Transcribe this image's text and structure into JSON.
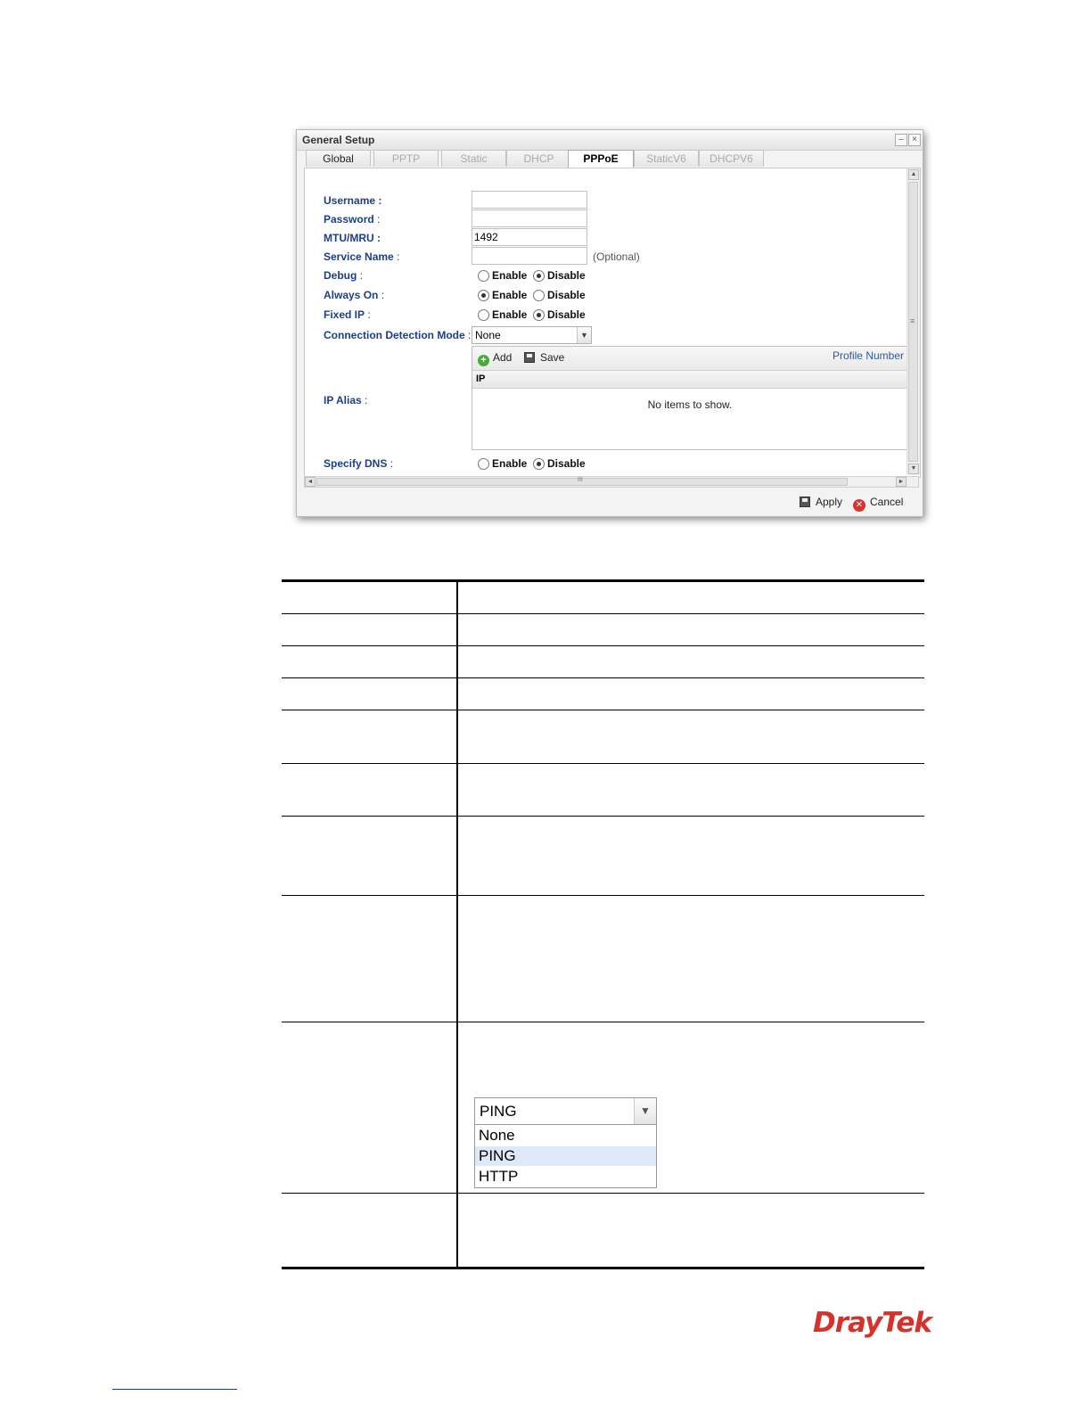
{
  "dialog": {
    "title": "General Setup",
    "minimize_glyph": "–",
    "close_glyph": "×",
    "tabs": [
      {
        "label": "Global",
        "state": "normal"
      },
      {
        "label": "PPTP",
        "state": "disabled"
      },
      {
        "label": "Static",
        "state": "disabled"
      },
      {
        "label": "DHCP",
        "state": "disabled"
      },
      {
        "label": "PPPoE",
        "state": "active"
      },
      {
        "label": "StaticV6",
        "state": "disabled"
      },
      {
        "label": "DHCPV6",
        "state": "disabled"
      }
    ],
    "form": {
      "username_label": "Username :",
      "username_value": "",
      "password_label": "Password",
      "password_colon": " :",
      "password_value": "",
      "mtu_label": "MTU/MRU :",
      "mtu_value": "1492",
      "service_label": "Service Name",
      "service_colon": " :",
      "service_value": "",
      "service_hint": "(Optional)",
      "debug_label": "Debug",
      "debug_colon": " :",
      "always_on_label": "Always On",
      "always_on_colon": " :",
      "fixed_ip_label": "Fixed IP",
      "fixed_ip_colon": " :",
      "conn_mode_label": "Connection Detection Mode",
      "conn_mode_colon": " :",
      "conn_mode_value": "None",
      "ip_alias_label": "IP Alias",
      "ip_alias_colon": " :",
      "specify_dns_label": "Specify DNS",
      "specify_dns_colon": " :",
      "enable_label": "Enable",
      "disable_label": "Disable",
      "radios": {
        "debug": "disable",
        "always_on": "enable",
        "fixed_ip": "disable",
        "specify_dns": "disable"
      }
    },
    "ip_alias_grid": {
      "add_label": "Add",
      "save_label": "Save",
      "profile_label": "Profile Number",
      "column_header": "IP",
      "empty_text": "No items to show."
    },
    "scroll_glyphs": {
      "up": "▲",
      "down": "▼",
      "left": "◄",
      "right": "►",
      "grip": "≡",
      "hgrip": "III"
    },
    "footer": {
      "apply_label": "Apply",
      "cancel_label": "Cancel"
    }
  },
  "detection_dropdown": {
    "selected": "PING",
    "options": [
      "None",
      "PING",
      "HTTP"
    ],
    "highlighted": "PING"
  },
  "brand": {
    "logo_text": "DrayTek",
    "accent_color": "#d6312a"
  }
}
